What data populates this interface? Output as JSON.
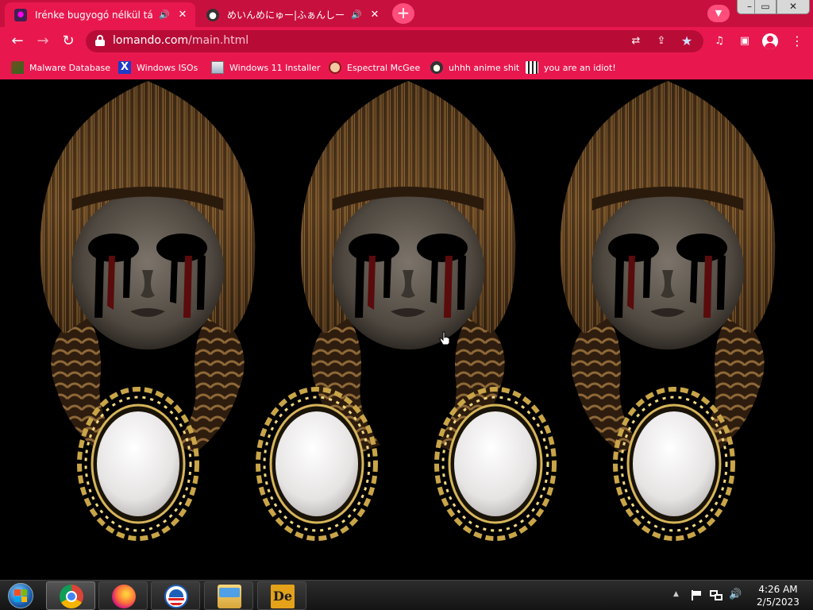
{
  "browser": {
    "tabs": [
      {
        "title": "Irénke bugyogó nélkül táncol",
        "favicon": "purple-face-icon",
        "audio": true,
        "active": true
      },
      {
        "title": "めいんめにゅー|ふぁんしーあいらんど",
        "favicon": "anime-face-icon",
        "audio": true,
        "active": false
      }
    ],
    "new_tab_label": "+",
    "tab_search_icon": "chevron-down-icon",
    "window_controls": {
      "minimize": "–",
      "maximize": "▭",
      "close": "✕"
    }
  },
  "toolbar": {
    "back": "←",
    "forward": "→",
    "reload": "↻",
    "url_domain": "lomando.com",
    "url_path": "/main.html",
    "translate": "⇄",
    "share": "⇪",
    "bookmark_star": "★",
    "media": "♫",
    "side_panel": "▣",
    "menu": "⋮"
  },
  "bookmarks": [
    {
      "label": "Malware Database",
      "icon": "malware-icon"
    },
    {
      "label": "Windows ISOs",
      "icon": "x-icon"
    },
    {
      "label": "Windows 11 Installer",
      "icon": "installer-icon"
    },
    {
      "label": "Espectral McGee",
      "icon": "face-icon"
    },
    {
      "label": "uhhh anime shit",
      "icon": "anime-icon"
    },
    {
      "label": "you are an idiot!",
      "icon": "idiot-icon"
    }
  ],
  "page": {
    "dolls": 3,
    "mirrors": 4
  },
  "taskbar": {
    "apps": [
      "chrome-icon",
      "firefox-icon",
      "obama-logo-icon",
      "file-explorer-icon",
      "de-app-icon"
    ],
    "tray_arrow": "▲",
    "volume": "🔊",
    "time": "4:26 AM",
    "date": "2/5/2023"
  },
  "colors": {
    "tab_strip": "#c8103e",
    "toolbar": "#e8184f",
    "omnibox": "#b80c37",
    "page_background": "#000000"
  }
}
